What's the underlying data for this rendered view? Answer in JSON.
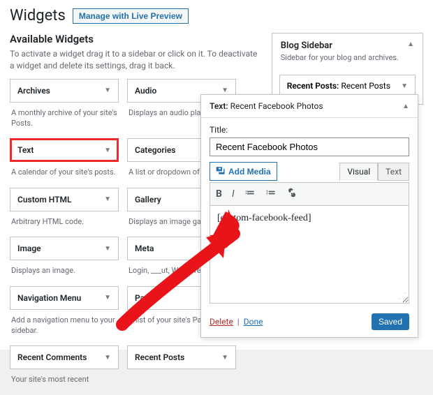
{
  "heading": "Widgets",
  "manage_button": "Manage with Live Preview",
  "available": {
    "title": "Available Widgets",
    "desc": "To activate a widget drag it to a sidebar or click on it. To deactivate a widget and delete its settings, drag it back.",
    "rows": [
      [
        {
          "name": "Archives",
          "desc": "A monthly archive of your site's Posts."
        },
        {
          "name": "Audio",
          "desc": "Displays an audio player."
        }
      ],
      [
        {
          "name": "Text",
          "desc": "A calendar of your site's posts.",
          "highlight": true
        },
        {
          "name": "Categories",
          "desc": "A list or dropdown of cate"
        }
      ],
      [
        {
          "name": "Custom HTML",
          "desc": "Arbitrary HTML code."
        },
        {
          "name": "Gallery",
          "desc": "Displays an image gallery"
        }
      ],
      [
        {
          "name": "Image",
          "desc": "Displays an image."
        },
        {
          "name": "Meta",
          "desc": "Login, ___ut, WordPre___ links."
        }
      ],
      [
        {
          "name": "Navigation Menu",
          "desc": "Add a navigation menu to your sidebar."
        },
        {
          "name": "Page",
          "desc": "A list of your site's Pages."
        }
      ],
      [
        {
          "name": "Recent Comments",
          "desc": "Your site's most recent"
        },
        {
          "name": "Recent Posts",
          "desc": ""
        }
      ]
    ]
  },
  "sidebar": {
    "title": "Blog Sidebar",
    "desc": "Sidebar for your blog and archives.",
    "item_label": "Recent Posts:",
    "item_value": "Recent Posts"
  },
  "editor": {
    "head_label": "Text:",
    "head_value": "Recent Facebook Photos",
    "title_label": "Title:",
    "title_value": "Recent Facebook Photos",
    "add_media": "Add Media",
    "tab_visual": "Visual",
    "tab_text": "Text",
    "content": "[custom-facebook-feed]",
    "delete": "Delete",
    "done": "Done",
    "saved": "Saved"
  }
}
